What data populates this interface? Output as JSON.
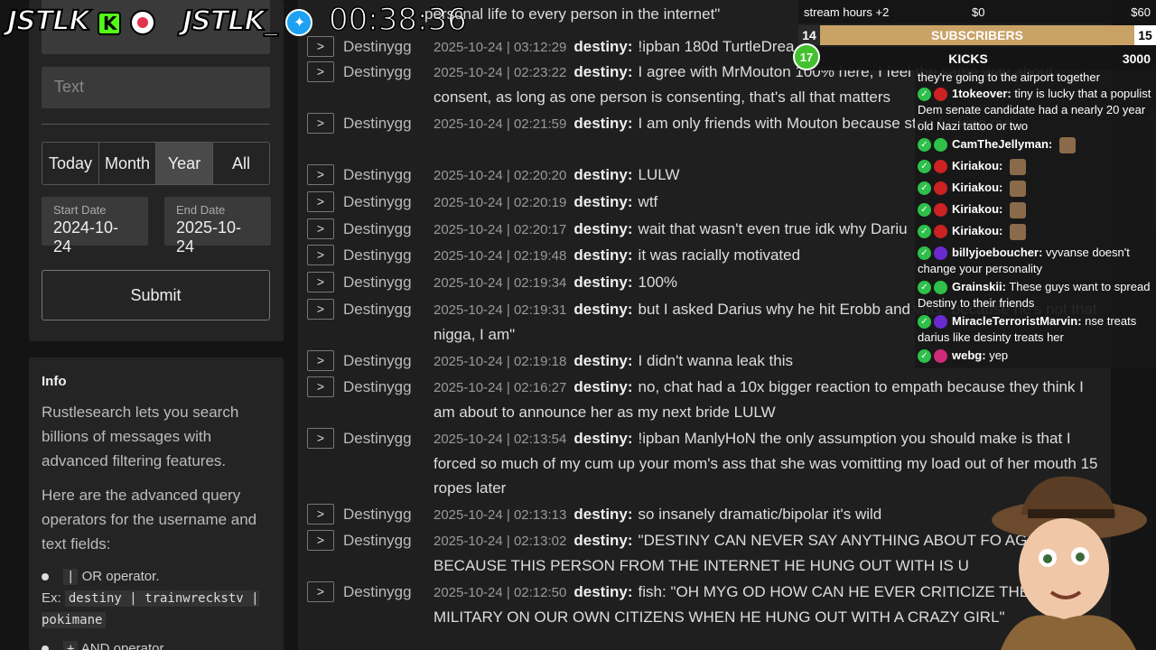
{
  "sidebar": {
    "text_placeholder": "Text",
    "ranges": [
      "Today",
      "Month",
      "Year",
      "All"
    ],
    "active_range": "Year",
    "start_date_label": "Start Date",
    "start_date": "2024-10-24",
    "end_date_label": "End Date",
    "end_date": "2025-10-24",
    "submit_label": "Submit"
  },
  "info": {
    "heading": "Info",
    "p1": "Rustlesearch lets you search billions of messages with advanced filtering features.",
    "p2": "Here are the advanced query operators for the username and text fields:",
    "op1_symbol": "|",
    "op1_desc": "OR operator.",
    "op1_ex_label": "Ex:",
    "op1_ex": "destiny | trainwreckstv | pokimane",
    "op2_symbol": "+",
    "op2_desc": "AND operator."
  },
  "overlay": {
    "brand1": "JSTLK",
    "brand2": "JSTLK_",
    "timer": "00:38:36",
    "top_cut_text": "personal life to every person in the internet\""
  },
  "goals": {
    "stream_hours_label": "stream hours +2",
    "stream_hours_min": "$0",
    "stream_hours_max": "$60",
    "subs_current": "14",
    "subs_label": "SUBSCRIBERS",
    "subs_goal": "15",
    "kicks_level": "17",
    "kicks_label": "KICKS",
    "kicks_goal": "3000"
  },
  "log": [
    {
      "user": "Destinygg",
      "ts": "2025-10-24 | 03:12:29",
      "who": "destiny:",
      "text": "!ipban 180d TurtleDrea..."
    },
    {
      "user": "Destinygg",
      "ts": "2025-10-24 | 02:23:22",
      "who": "destiny:",
      "text": "I agree with MrMouton 100% here, I feel the same way about consent, as long as one person is consenting, that's all that matters"
    },
    {
      "user": "Destinygg",
      "ts": "2025-10-24 | 02:21:59",
      "who": "destiny:",
      "text": "I am only friends with Mouton because stop fucking me"
    },
    {
      "user": "Destinygg",
      "ts": "2025-10-24 | 02:20:20",
      "who": "destiny:",
      "text": "LULW"
    },
    {
      "user": "Destinygg",
      "ts": "2025-10-24 | 02:20:19",
      "who": "destiny:",
      "text": "wtf"
    },
    {
      "user": "Destinygg",
      "ts": "2025-10-24 | 02:20:17",
      "who": "destiny:",
      "text": "wait that wasn't even true idk why Dariu"
    },
    {
      "user": "Destinygg",
      "ts": "2025-10-24 | 02:19:48",
      "who": "destiny:",
      "text": "it was racially motivated"
    },
    {
      "user": "Destinygg",
      "ts": "2025-10-24 | 02:19:34",
      "who": "destiny:",
      "text": "100%"
    },
    {
      "user": "Destinygg",
      "ts": "2025-10-24 | 02:19:31",
      "who": "destiny:",
      "text": "but I asked Darius why he hit Erobb and was \"because he's not that nigga, I am\""
    },
    {
      "user": "Destinygg",
      "ts": "2025-10-24 | 02:19:18",
      "who": "destiny:",
      "text": "I didn't wanna leak this"
    },
    {
      "user": "Destinygg",
      "ts": "2025-10-24 | 02:16:27",
      "who": "destiny:",
      "text": "no, chat had a 10x bigger reaction to empath because they think I am about to announce her as my next bride LULW"
    },
    {
      "user": "Destinygg",
      "ts": "2025-10-24 | 02:13:54",
      "who": "destiny:",
      "text": "!ipban ManlyHoN the only assumption you should make is that I forced so much of my cum up your mom's ass that she was vomitting my load out of her mouth 15 ropes later"
    },
    {
      "user": "Destinygg",
      "ts": "2025-10-24 | 02:13:13",
      "who": "destiny:",
      "text": "so insanely dramatic/bipolar it's wild"
    },
    {
      "user": "Destinygg",
      "ts": "2025-10-24 | 02:13:02",
      "who": "destiny:",
      "text": "\"DESTINY CAN NEVER SAY ANYTHING ABOUT FO AGAIN BECAUSE THIS PERSON FROM THE INTERNET HE HUNG OUT WITH IS U"
    },
    {
      "user": "Destinygg",
      "ts": "2025-10-24 | 02:12:50",
      "who": "destiny:",
      "text": "fish: \"OH MYG OD HOW CAN HE EVER CRITICIZE THE MILITARY ON OUR OWN CITIZENS WHEN HE HUNG OUT WITH A CRAZY GIRL\""
    }
  ],
  "chat": {
    "top_cut": "they're going to the airport together",
    "messages": [
      {
        "name": "1tokeover:",
        "text": "tiny is lucky that a populist Dem senate candidate had a nearly 20 year old Nazi tattoo or two",
        "dot": "#cc2222"
      },
      {
        "name": "CamTheJellyman:",
        "text": "",
        "dot": "#2ec04a"
      },
      {
        "name": "Kiriakou:",
        "text": "",
        "dot": "#cc2222"
      },
      {
        "name": "Kiriakou:",
        "text": "",
        "dot": "#cc2222"
      },
      {
        "name": "Kiriakou:",
        "text": "",
        "dot": "#cc2222"
      },
      {
        "name": "Kiriakou:",
        "text": "",
        "dot": "#cc2222"
      },
      {
        "name": "billyjoeboucher:",
        "text": "vyvanse doesn't change your personality",
        "dot": "#6a2ad0"
      },
      {
        "name": "Grainskii:",
        "text": "These guys want to spread Destiny to their friends",
        "dot": "#2ec04a"
      },
      {
        "name": "MiracleTerroristMarvin:",
        "text": "nse treats darius like desinty treats her",
        "dot": "#6a2ad0"
      },
      {
        "name": "webg:",
        "text": "yep",
        "dot": "#d02a7a"
      }
    ]
  }
}
